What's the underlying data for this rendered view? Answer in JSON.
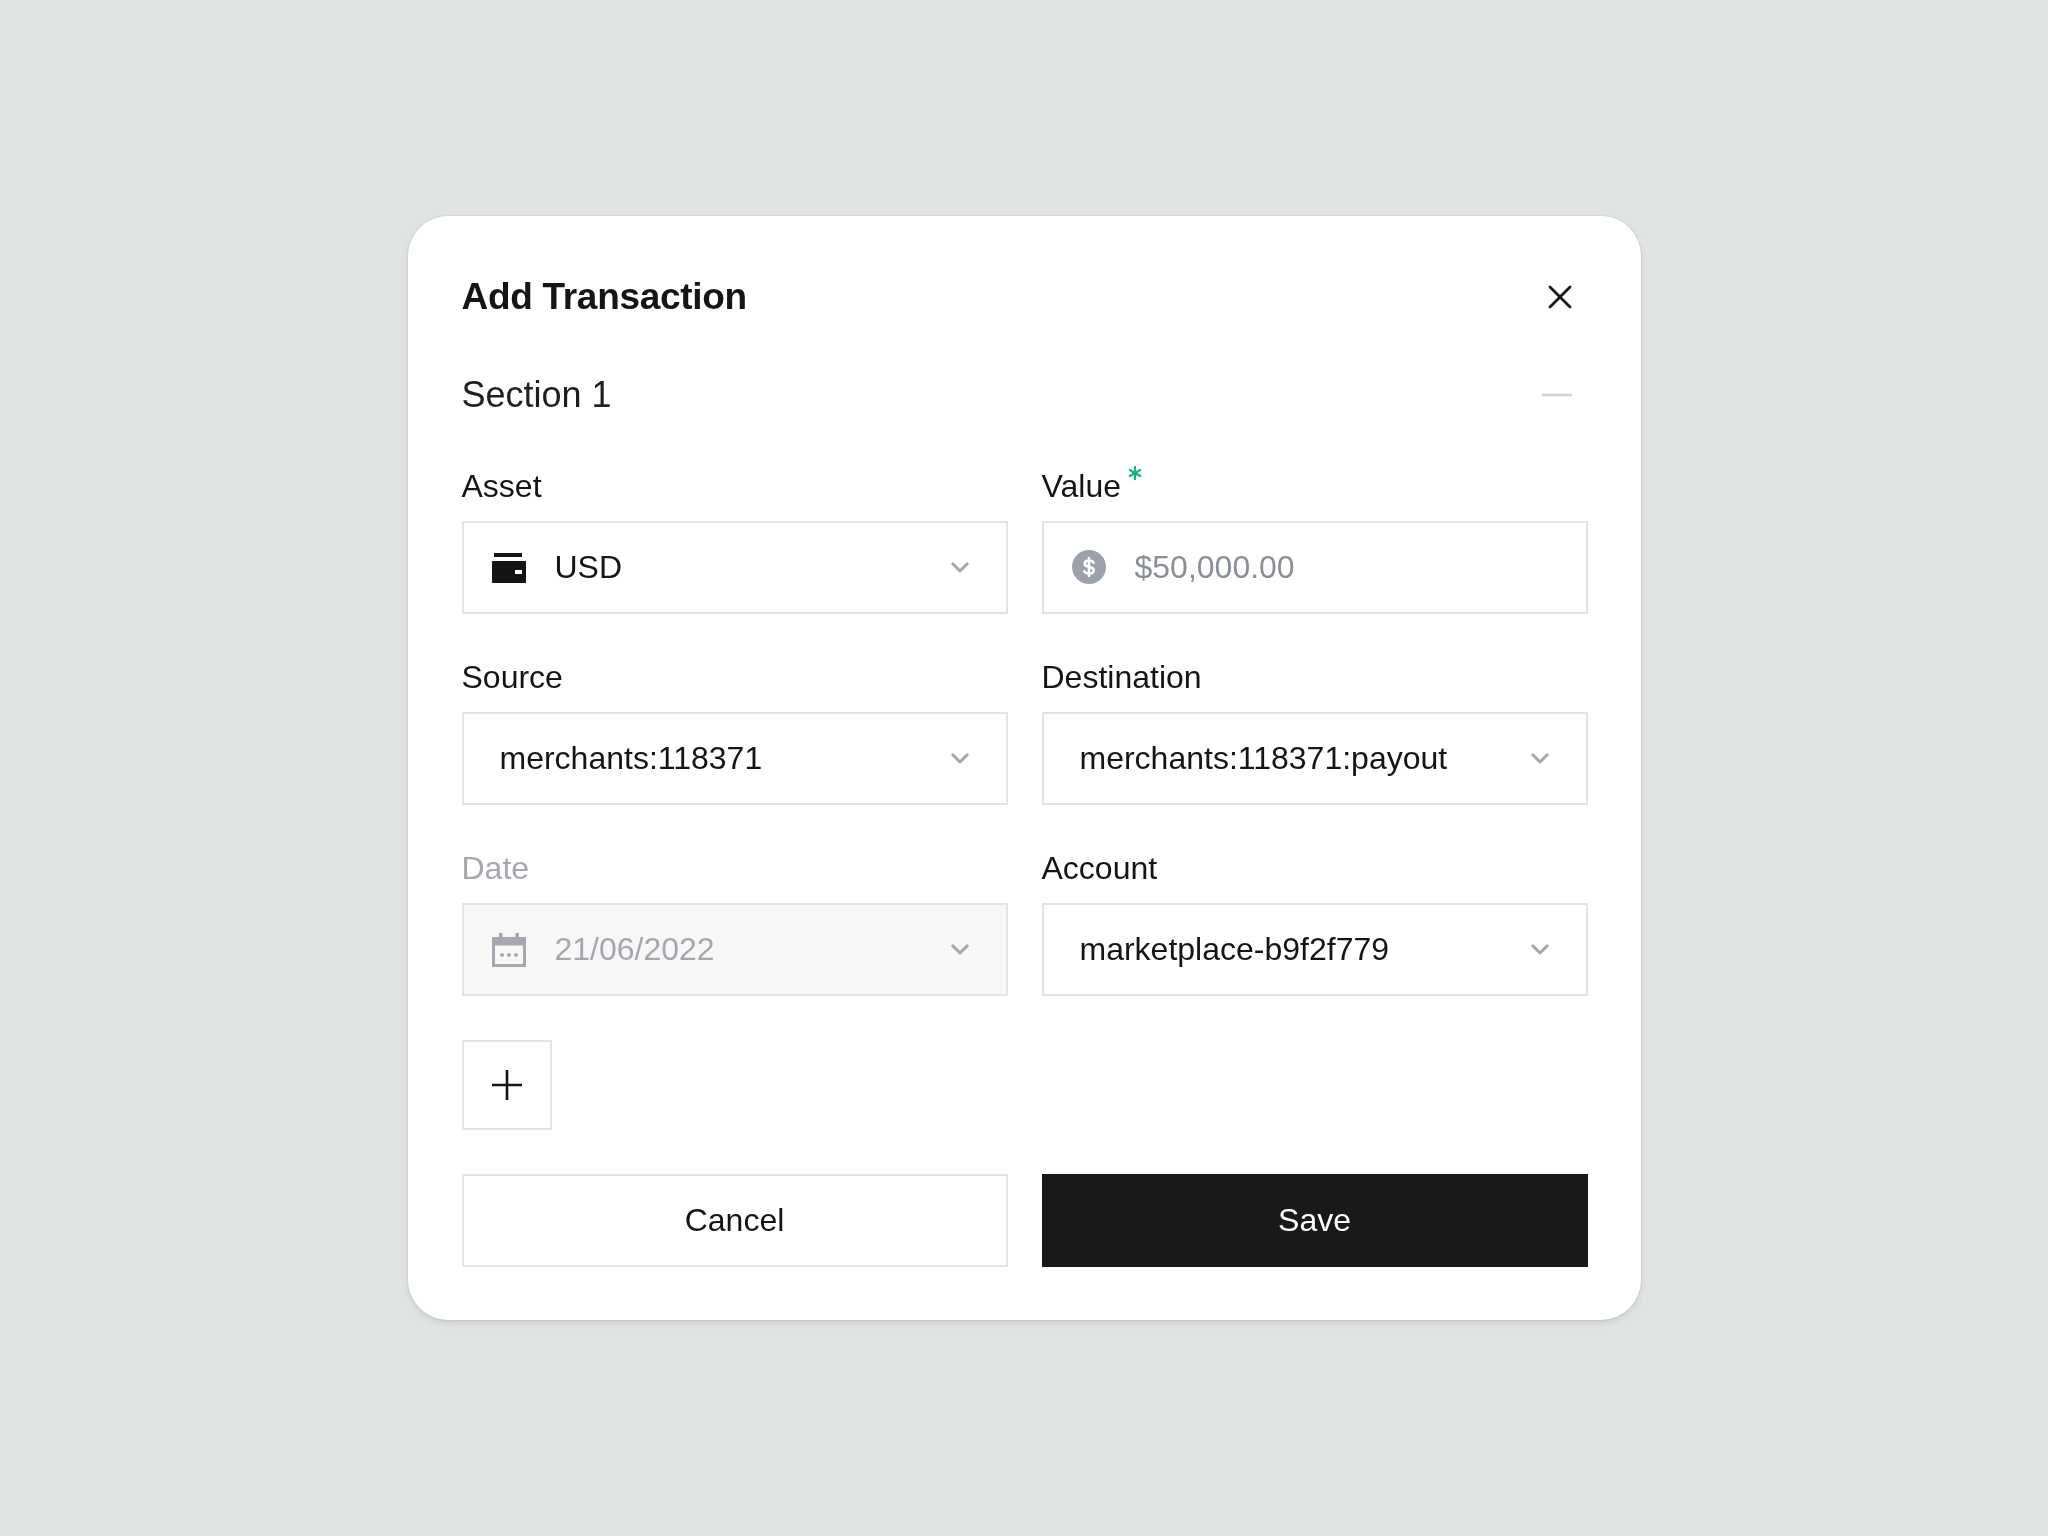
{
  "dialog": {
    "title": "Add Transaction"
  },
  "section": {
    "title": "Section 1",
    "expanded": true
  },
  "fields": [
    {
      "label": "Asset",
      "kind": "asset",
      "value": "USD",
      "required": false,
      "disabled": false
    },
    {
      "label": "Value",
      "kind": "amount",
      "placeholder": "$50,000.00",
      "required": true,
      "disabled": false
    },
    {
      "label": "Source",
      "kind": "select",
      "value": "merchants:118371",
      "required": false,
      "disabled": false
    },
    {
      "label": "Destination",
      "kind": "select",
      "value": "merchants:118371:payout",
      "required": false,
      "disabled": false
    },
    {
      "label": "Date",
      "kind": "date",
      "value": "21/06/2022",
      "required": false,
      "disabled": true
    },
    {
      "label": "Account",
      "kind": "select",
      "value": "marketplace-b9f2f779",
      "required": false,
      "disabled": false
    }
  ],
  "buttons": [
    {
      "label": "Cancel",
      "kind": "secondary"
    },
    {
      "label": "Save",
      "kind": "primary"
    }
  ]
}
